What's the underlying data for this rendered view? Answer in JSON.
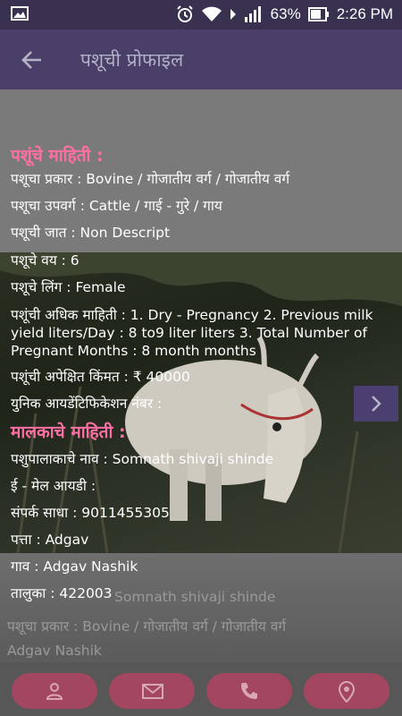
{
  "status_bar": {
    "battery_percent": "63%",
    "time": "2:26 PM"
  },
  "app_bar": {
    "title": "पशूची प्रोफाइल"
  },
  "animal_section": {
    "heading": "पशूंचे माहिती :",
    "type": "पशूचा प्रकार : Bovine / गोजातीय वर्ग / गोजातीय वर्ग",
    "subtype": "पशूचा उपवर्ग : Cattle / गाई - गुरे / गाय",
    "breed": "पशूची जात : Non Descript",
    "age": "पशूचे वय : 6",
    "gender": "पशूचे लिंग : Female",
    "extra_info": "पशूंची अधिक माहिती : 1. Dry - Pregnancy 2. Previous milk yield liters/Day : 8 to9 liter liters 3. Total Number of Pregnant Months : 8 month months",
    "expected_price": "पशूंची अपेक्षित किंमत : ₹ 40000",
    "unique_id": "युनिक आयडेंटिफिकेशन नंबर :"
  },
  "owner_section": {
    "heading": "मालकाचे माहिती :",
    "name": "पशुपालाकाचे नाव : Somnath shivaji shinde",
    "email": "ई - मेल आयडी :",
    "contact": "संपर्क साधा : 9011455305",
    "address": "पत्ता : Adgav",
    "village": "गाव : Adgav Nashik",
    "taluka": "तालुका : 422003"
  },
  "background_card": {
    "owner_name": "Somnath shivaji shinde",
    "type": "पशूचा प्रकार : Bovine / गोजातीय वर्ग / गोजातीय वर्ग",
    "location": "Adgav Nashik"
  },
  "actions": [
    "person-icon",
    "mail-icon",
    "phone-icon",
    "location-icon"
  ],
  "colors": {
    "heading": "#ff6fa3",
    "app_bar": "#4a3f68",
    "action_button": "#a2475f"
  }
}
